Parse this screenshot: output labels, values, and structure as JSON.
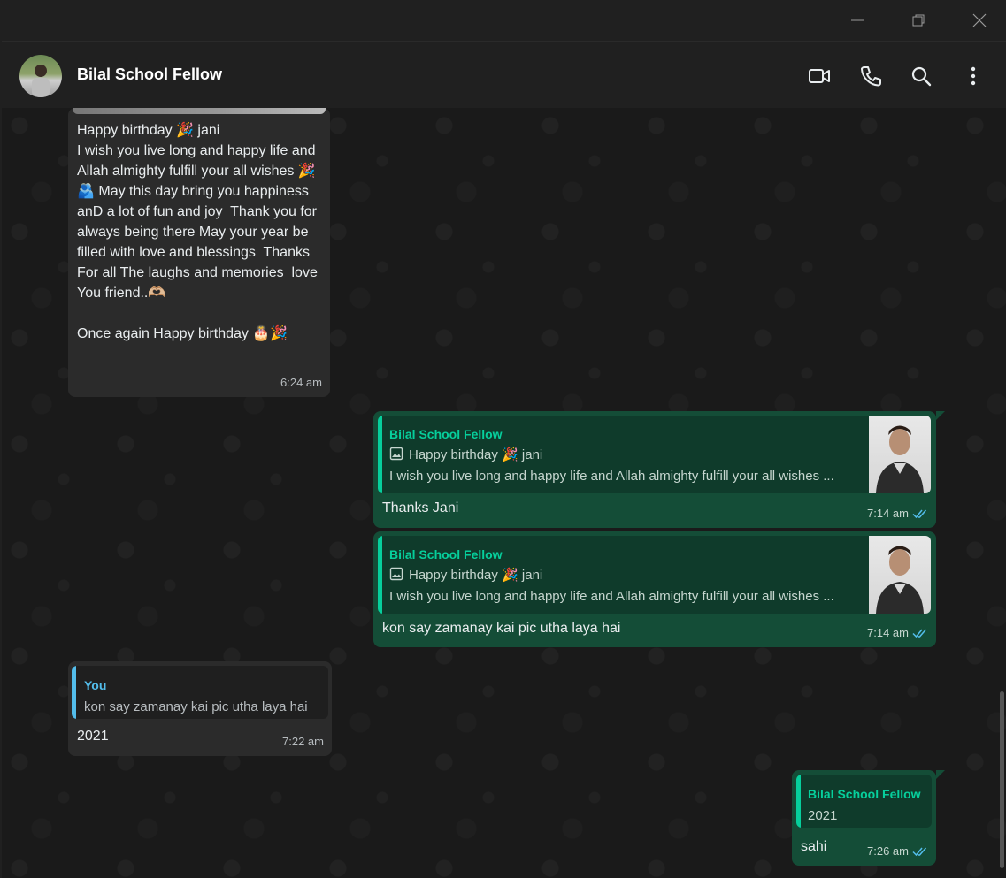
{
  "header": {
    "contact_name": "Bilal School Fellow"
  },
  "messages": {
    "m1": {
      "text": "Happy birthday 🎉 jani\nI wish you live long and happy life and Allah almighty fulfill your all wishes 🎉🫂 May this day bring you happiness anD a lot of fun and joy  Thank you for always being there May your year be filled with love and blessings  Thanks For all The laughs and memories  love You friend..🫶🏼\n\nOnce again Happy birthday 🎂🎉",
      "time": "6:24 am"
    },
    "m2": {
      "quote_name": "Bilal School Fellow",
      "quote_line1": "Happy birthday 🎉 jani",
      "quote_line2": "I wish you live long and happy life and Allah almighty fulfill your all wishes ...",
      "text": "Thanks Jani",
      "time": "7:14 am"
    },
    "m3": {
      "quote_name": "Bilal School Fellow",
      "quote_line1": "Happy birthday 🎉 jani",
      "quote_line2": "I wish you live long and happy life and Allah almighty fulfill your all wishes ...",
      "text": "kon say zamanay kai pic utha laya hai",
      "time": "7:14 am"
    },
    "m4": {
      "quote_name": "You",
      "quote_line": "kon say zamanay kai pic utha laya hai",
      "text": "2021",
      "time": "7:22 am"
    },
    "m5": {
      "quote_name": "Bilal School Fellow",
      "quote_line": "2021",
      "text": "sahi",
      "time": "7:26 am"
    }
  },
  "icons": {
    "video": "video-call-icon",
    "call": "phone-icon",
    "search": "search-icon",
    "menu": "more-vertical-icon",
    "image": "image-icon",
    "ticks": "double-check-icon"
  },
  "colors": {
    "accent_green": "#06cf9c",
    "quote_blue": "#53bdeb",
    "outgoing_bubble": "#144d37",
    "incoming_bubble": "#2b2b2b",
    "read_ticks": "#53bdeb"
  }
}
